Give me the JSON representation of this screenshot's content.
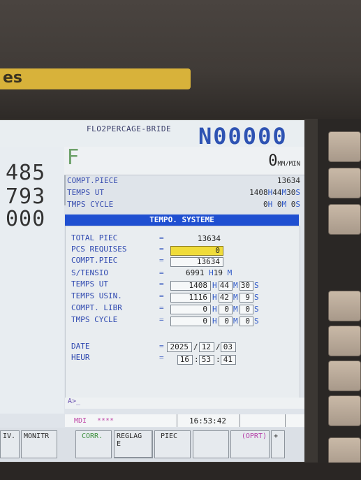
{
  "header": {
    "label_fragment": "es",
    "program_name": "FLO2PERCAGE-BRIDE",
    "program_number": "N00000"
  },
  "left_position": [
    "485",
    "793",
    "000"
  ],
  "feed": {
    "letter": "F",
    "value": "0",
    "unit": "MM/MIN"
  },
  "counters": [
    {
      "label": "COMPT.PIECE",
      "value": "13634"
    },
    {
      "label": "TEMPS UT",
      "h": "1408",
      "m": "44",
      "s": "30"
    },
    {
      "label": "TMPS CYCLE",
      "h": "0",
      "m": "0",
      "s": "0"
    }
  ],
  "panel": {
    "title": "TEMPO. SYSTEME",
    "rows": [
      {
        "label": "TOTAL PIEC",
        "value": "13634"
      },
      {
        "label": "PCS REQUISES",
        "value": "0"
      },
      {
        "label": "COMPT.PIEC",
        "value": "13634"
      },
      {
        "label": "S/TENSIO",
        "h": "6991",
        "m": "19"
      },
      {
        "label": "TEMPS UT",
        "h": "1408",
        "m": "44",
        "s": "30"
      },
      {
        "label": "TEMPS USIN.",
        "h": "1116",
        "m": "42",
        "s": "9"
      },
      {
        "label": "COMPT. LIBR",
        "h": "0",
        "m": "0",
        "s": "0"
      },
      {
        "label": "TMPS CYCLE",
        "h": "0",
        "m": "0",
        "s": "0"
      }
    ],
    "date_label": "DATE",
    "date": {
      "y": "2025",
      "mo": "12",
      "d": "03"
    },
    "time_label": "HEUR",
    "time": {
      "h": "16",
      "m": "53",
      "s": "41"
    },
    "unit_h": "H",
    "unit_m": "M",
    "unit_s": "S",
    "eq": "="
  },
  "command_line": "A>_",
  "status": {
    "mode": "MDI",
    "stars": "****",
    "clock": "16:53:42"
  },
  "softkeys": [
    "IV.",
    "MONITR",
    "CORR.",
    "REGLAG\nE",
    "PIEC",
    "",
    "(OPRT)",
    "+"
  ]
}
